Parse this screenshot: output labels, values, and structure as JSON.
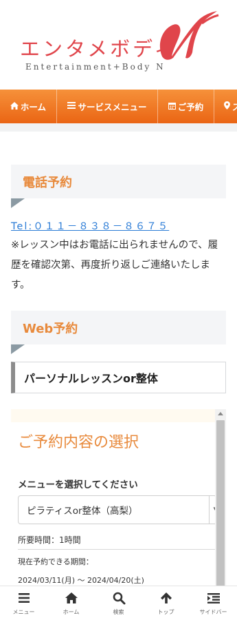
{
  "logo": {
    "main": "エンタメボディ",
    "sub": "Entertainment+Body N"
  },
  "nav": [
    {
      "label": "ホーム",
      "icon": "home-icon"
    },
    {
      "label": "サービスメニュー",
      "icon": "list-icon"
    },
    {
      "label": "ご予約",
      "icon": "calendar-icon"
    },
    {
      "label": "ス",
      "icon": "map-pin-icon"
    }
  ],
  "phone_section": {
    "heading": "電話予約",
    "tel": "Tel:０１１－８３８－８６７５",
    "notice": "※レッスン中はお電話に出られませんので、履歴を確認次第、再度折り返しご連絡いたします。"
  },
  "web_section": {
    "heading": "Web予約",
    "subheading": "パーソナルレッスンor整体"
  },
  "booking": {
    "title": "ご予約内容の選択",
    "menu_label": "メニューを選択してください",
    "selected": "ピラティスor整体（高梨）",
    "duration": "所要時間：1時間",
    "period_label": "現在予約できる期間：",
    "period_range": "2024/03/11(月) ～ 2024/04/20(土)"
  },
  "bottom_nav": [
    {
      "label": "メニュー",
      "icon": "menu-icon"
    },
    {
      "label": "ホーム",
      "icon": "home-icon"
    },
    {
      "label": "検索",
      "icon": "search-icon"
    },
    {
      "label": "トップ",
      "icon": "arrow-up-icon"
    },
    {
      "label": "サイドバー",
      "icon": "sidebar-icon"
    }
  ],
  "colors": {
    "accent_orange": "#e88a3c",
    "nav_gradient_top": "#f6913a",
    "nav_gradient_bottom": "#ea6514",
    "logo_red": "#e0454b",
    "link_blue": "#2a7bd6"
  }
}
